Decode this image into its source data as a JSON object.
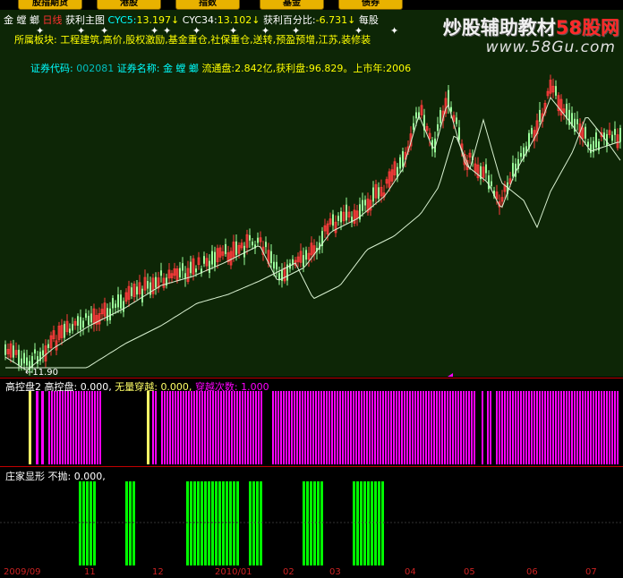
{
  "tabs": [
    "股指期货",
    "港股",
    "指数",
    "基金",
    "债券"
  ],
  "header": {
    "stock_name": "金 螳 螂",
    "period": "日线",
    "indicator": "获利主图",
    "cyc5_label": "CYC5:",
    "cyc5_value": "13.197↓",
    "cyc34_label": "CYC34:",
    "cyc34_value": "13.102↓",
    "profit_pct_label": "获利百分比:",
    "profit_pct_value": "-6.731↓",
    "per_share": "每股",
    "sector_line": "所属板块:  工程建筑,高价,股权激励,基金重仓,社保重仓,送转,预盈预增,江苏,装修装"
  },
  "info": {
    "code_label": "证券代码:",
    "code_value": "002081",
    "name_label": "证券名称:",
    "name_value": "金 螳 螂",
    "float_label": "流通盘:",
    "float_value": "2.842亿",
    "profit_label": "获利盘:",
    "profit_value": "96.829。",
    "listing_label": "上市年:",
    "listing_value": "2006"
  },
  "low_marker": "←11.90",
  "panel2": {
    "title": "高控盘2",
    "f1_label": "高控盘:",
    "f1_value": "0.000,",
    "f2_label": "无量穿越:",
    "f2_value": "0.000,",
    "f3_label": "穿越次数:",
    "f3_value": "1.000"
  },
  "panel3": {
    "title": "庄家显形",
    "f1_label": "不抛:",
    "f1_value": "0.000,"
  },
  "watermark": {
    "text_a": "炒股辅助教材",
    "text_b": "58股网",
    "url": "www.58Gu.com"
  },
  "xaxis": [
    "2009/09",
    "11",
    "12",
    "2010/01",
    "02",
    "03",
    "04",
    "05",
    "06",
    "07"
  ],
  "colors": {
    "up": "#ff3b3b",
    "down": "#9aff9a",
    "ma_line": "#d8f0d0",
    "magenta": "#ff00ff",
    "green_bar": "#00ff00",
    "yellow": "#ffff66",
    "header_cyan": "#00ffff",
    "header_yellow": "#ffff00"
  }
}
